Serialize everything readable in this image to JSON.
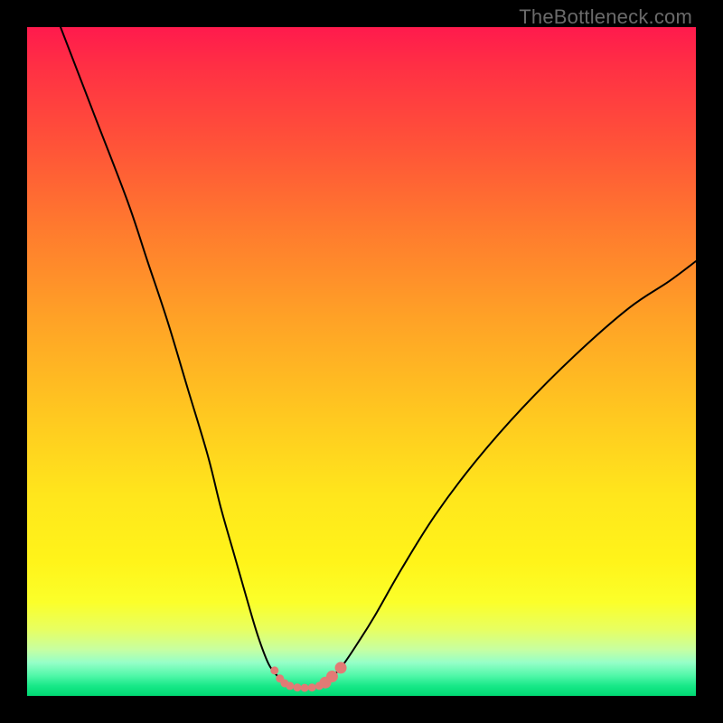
{
  "watermark": "TheBottleneck.com",
  "chart_data": {
    "type": "line",
    "title": "",
    "xlabel": "",
    "ylabel": "",
    "xlim": [
      0,
      100
    ],
    "ylim": [
      0,
      100
    ],
    "grid": false,
    "axes_visible": false,
    "series": [
      {
        "name": "left-curve",
        "stroke": "#000000",
        "stroke_width": 2,
        "x": [
          5,
          10,
          15,
          18,
          21,
          24,
          27,
          29,
          31,
          33,
          34.5,
          36,
          37,
          38
        ],
        "values": [
          100,
          87,
          74,
          65,
          56,
          46,
          36,
          28,
          21,
          14,
          9,
          5,
          3.5,
          2.3
        ]
      },
      {
        "name": "right-curve",
        "stroke": "#000000",
        "stroke_width": 2,
        "x": [
          45,
          46,
          47.5,
          49.5,
          52,
          56,
          61,
          67,
          74,
          82,
          90,
          96,
          100
        ],
        "values": [
          2.3,
          3.2,
          5,
          8,
          12,
          19,
          27,
          35,
          43,
          51,
          58,
          62,
          65
        ]
      },
      {
        "name": "floor-segment",
        "stroke": "#000000",
        "stroke_width": 2,
        "x": [
          38,
          39,
          41.5,
          44,
          45
        ],
        "values": [
          2.3,
          1.5,
          1.2,
          1.5,
          2.3
        ]
      }
    ],
    "markers": {
      "name": "trough-markers",
      "fill": "#e27a75",
      "radius_small": 4.5,
      "radius_large": 6.5,
      "stroke": "none",
      "points": [
        {
          "x": 37.0,
          "y": 3.8,
          "size": "small"
        },
        {
          "x": 37.8,
          "y": 2.6,
          "size": "small"
        },
        {
          "x": 38.5,
          "y": 1.9,
          "size": "small"
        },
        {
          "x": 39.3,
          "y": 1.5,
          "size": "small"
        },
        {
          "x": 40.4,
          "y": 1.25,
          "size": "small"
        },
        {
          "x": 41.5,
          "y": 1.2,
          "size": "small"
        },
        {
          "x": 42.6,
          "y": 1.25,
          "size": "small"
        },
        {
          "x": 43.7,
          "y": 1.5,
          "size": "small"
        },
        {
          "x": 44.6,
          "y": 2.0,
          "size": "large"
        },
        {
          "x": 45.6,
          "y": 2.9,
          "size": "large"
        },
        {
          "x": 46.9,
          "y": 4.2,
          "size": "large"
        }
      ]
    },
    "background_gradient": {
      "direction": "vertical",
      "stops": [
        {
          "y": 100,
          "color": "#ff1a4d"
        },
        {
          "y": 50,
          "color": "#ffc820"
        },
        {
          "y": 10,
          "color": "#fbff2a"
        },
        {
          "y": 0,
          "color": "#00d973"
        }
      ]
    }
  }
}
